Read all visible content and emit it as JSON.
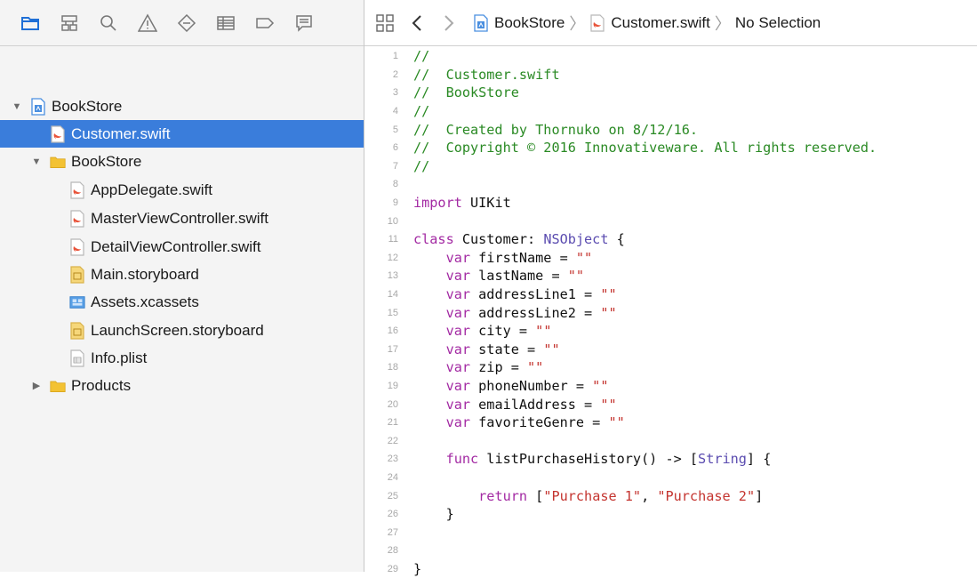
{
  "navigator": {
    "toolbar_icons": [
      "folder-icon",
      "hierarchy-icon",
      "search-icon",
      "warning-icon",
      "diamond-icon",
      "list-icon",
      "tag-icon",
      "comment-icon"
    ],
    "tree": [
      {
        "label": "BookStore",
        "icon": "project-icon",
        "indent": 0,
        "disclosure": "open",
        "selected": false
      },
      {
        "label": "Customer.swift",
        "icon": "swift-file-icon",
        "indent": 1,
        "disclosure": "none",
        "selected": true
      },
      {
        "label": "BookStore",
        "icon": "folder-icon",
        "indent": 1,
        "disclosure": "open",
        "selected": false
      },
      {
        "label": "AppDelegate.swift",
        "icon": "swift-file-icon",
        "indent": 2,
        "disclosure": "none",
        "selected": false
      },
      {
        "label": "MasterViewController.swift",
        "icon": "swift-file-icon",
        "indent": 2,
        "disclosure": "none",
        "selected": false
      },
      {
        "label": "DetailViewController.swift",
        "icon": "swift-file-icon",
        "indent": 2,
        "disclosure": "none",
        "selected": false
      },
      {
        "label": "Main.storyboard",
        "icon": "storyboard-icon",
        "indent": 2,
        "disclosure": "none",
        "selected": false
      },
      {
        "label": "Assets.xcassets",
        "icon": "assets-icon",
        "indent": 2,
        "disclosure": "none",
        "selected": false
      },
      {
        "label": "LaunchScreen.storyboard",
        "icon": "storyboard-icon",
        "indent": 2,
        "disclosure": "none",
        "selected": false
      },
      {
        "label": "Info.plist",
        "icon": "plist-icon",
        "indent": 2,
        "disclosure": "none",
        "selected": false
      },
      {
        "label": "Products",
        "icon": "folder-icon",
        "indent": 1,
        "disclosure": "closed",
        "selected": false
      }
    ]
  },
  "jumpbar": {
    "crumbs": [
      {
        "label": "BookStore",
        "icon": "project-icon"
      },
      {
        "label": "Customer.swift",
        "icon": "swift-file-icon"
      },
      {
        "label": "No Selection",
        "icon": ""
      }
    ]
  },
  "editor": {
    "lines": [
      [
        {
          "t": "comment",
          "s": "//"
        }
      ],
      [
        {
          "t": "comment",
          "s": "//  Customer.swift"
        }
      ],
      [
        {
          "t": "comment",
          "s": "//  BookStore"
        }
      ],
      [
        {
          "t": "comment",
          "s": "//"
        }
      ],
      [
        {
          "t": "comment",
          "s": "//  Created by Thornuko on 8/12/16."
        }
      ],
      [
        {
          "t": "comment",
          "s": "//  Copyright © 2016 Innovativeware. All rights reserved."
        }
      ],
      [
        {
          "t": "comment",
          "s": "//"
        }
      ],
      [],
      [
        {
          "t": "kw",
          "s": "import"
        },
        {
          "t": "plain",
          "s": " UIKit"
        }
      ],
      [],
      [
        {
          "t": "kw",
          "s": "class"
        },
        {
          "t": "plain",
          "s": " Customer: "
        },
        {
          "t": "type",
          "s": "NSObject"
        },
        {
          "t": "plain",
          "s": " {"
        }
      ],
      [
        {
          "t": "plain",
          "s": "    "
        },
        {
          "t": "kw",
          "s": "var"
        },
        {
          "t": "plain",
          "s": " firstName = "
        },
        {
          "t": "str",
          "s": "\"\""
        }
      ],
      [
        {
          "t": "plain",
          "s": "    "
        },
        {
          "t": "kw",
          "s": "var"
        },
        {
          "t": "plain",
          "s": " lastName = "
        },
        {
          "t": "str",
          "s": "\"\""
        }
      ],
      [
        {
          "t": "plain",
          "s": "    "
        },
        {
          "t": "kw",
          "s": "var"
        },
        {
          "t": "plain",
          "s": " addressLine1 = "
        },
        {
          "t": "str",
          "s": "\"\""
        }
      ],
      [
        {
          "t": "plain",
          "s": "    "
        },
        {
          "t": "kw",
          "s": "var"
        },
        {
          "t": "plain",
          "s": " addressLine2 = "
        },
        {
          "t": "str",
          "s": "\"\""
        }
      ],
      [
        {
          "t": "plain",
          "s": "    "
        },
        {
          "t": "kw",
          "s": "var"
        },
        {
          "t": "plain",
          "s": " city = "
        },
        {
          "t": "str",
          "s": "\"\""
        }
      ],
      [
        {
          "t": "plain",
          "s": "    "
        },
        {
          "t": "kw",
          "s": "var"
        },
        {
          "t": "plain",
          "s": " state = "
        },
        {
          "t": "str",
          "s": "\"\""
        }
      ],
      [
        {
          "t": "plain",
          "s": "    "
        },
        {
          "t": "kw",
          "s": "var"
        },
        {
          "t": "plain",
          "s": " zip = "
        },
        {
          "t": "str",
          "s": "\"\""
        }
      ],
      [
        {
          "t": "plain",
          "s": "    "
        },
        {
          "t": "kw",
          "s": "var"
        },
        {
          "t": "plain",
          "s": " phoneNumber = "
        },
        {
          "t": "str",
          "s": "\"\""
        }
      ],
      [
        {
          "t": "plain",
          "s": "    "
        },
        {
          "t": "kw",
          "s": "var"
        },
        {
          "t": "plain",
          "s": " emailAddress = "
        },
        {
          "t": "str",
          "s": "\"\""
        }
      ],
      [
        {
          "t": "plain",
          "s": "    "
        },
        {
          "t": "kw",
          "s": "var"
        },
        {
          "t": "plain",
          "s": " favoriteGenre = "
        },
        {
          "t": "str",
          "s": "\"\""
        }
      ],
      [],
      [
        {
          "t": "plain",
          "s": "    "
        },
        {
          "t": "kw",
          "s": "func"
        },
        {
          "t": "plain",
          "s": " listPurchaseHistory() -> ["
        },
        {
          "t": "type",
          "s": "String"
        },
        {
          "t": "plain",
          "s": "] {"
        }
      ],
      [],
      [
        {
          "t": "plain",
          "s": "        "
        },
        {
          "t": "kw",
          "s": "return"
        },
        {
          "t": "plain",
          "s": " ["
        },
        {
          "t": "str",
          "s": "\"Purchase 1\""
        },
        {
          "t": "plain",
          "s": ", "
        },
        {
          "t": "str",
          "s": "\"Purchase 2\""
        },
        {
          "t": "plain",
          "s": "]"
        }
      ],
      [
        {
          "t": "plain",
          "s": "    }"
        }
      ],
      [],
      [],
      [
        {
          "t": "plain",
          "s": "}"
        }
      ]
    ]
  },
  "colors": {
    "selection": "#3a7ddb",
    "comment": "#2a8a24",
    "keyword": "#a32aa3",
    "type": "#5b4cb0",
    "string": "#c4342f",
    "toolbar_icon": "#1f6fd6"
  }
}
